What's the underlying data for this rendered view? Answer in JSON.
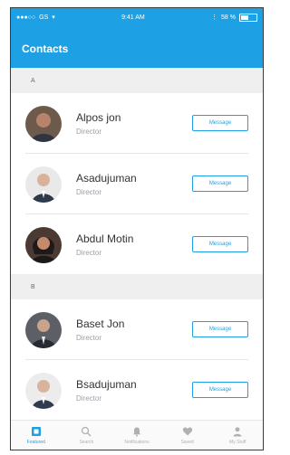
{
  "status_bar": {
    "carrier": "GS",
    "time": "9:41 AM",
    "battery_text": "58 %",
    "battery_level": 0.58
  },
  "header": {
    "title": "Contacts"
  },
  "sections": [
    {
      "letter": "A",
      "contacts": [
        {
          "name": "Alpos jon",
          "role": "Director",
          "action": "Message"
        },
        {
          "name": "Asadujuman",
          "role": "Director",
          "action": "Message"
        },
        {
          "name": "Abdul Motin",
          "role": "Director",
          "action": "Message"
        }
      ]
    },
    {
      "letter": "B",
      "contacts": [
        {
          "name": "Baset Jon",
          "role": "Director",
          "action": "Message"
        },
        {
          "name": "Bsadujuman",
          "role": "Director",
          "action": "Message"
        }
      ]
    }
  ],
  "tabs": [
    {
      "label": "Featured",
      "icon": "featured-icon",
      "active": true
    },
    {
      "label": "Search",
      "icon": "search-icon",
      "active": false
    },
    {
      "label": "Notifications",
      "icon": "bell-icon",
      "active": false
    },
    {
      "label": "Saved",
      "icon": "heart-icon",
      "active": false
    },
    {
      "label": "My Stuff",
      "icon": "person-icon",
      "active": false
    }
  ],
  "colors": {
    "accent": "#1ea1e4",
    "section_bg": "#efefef",
    "tab_inactive": "#b0b0b0"
  }
}
